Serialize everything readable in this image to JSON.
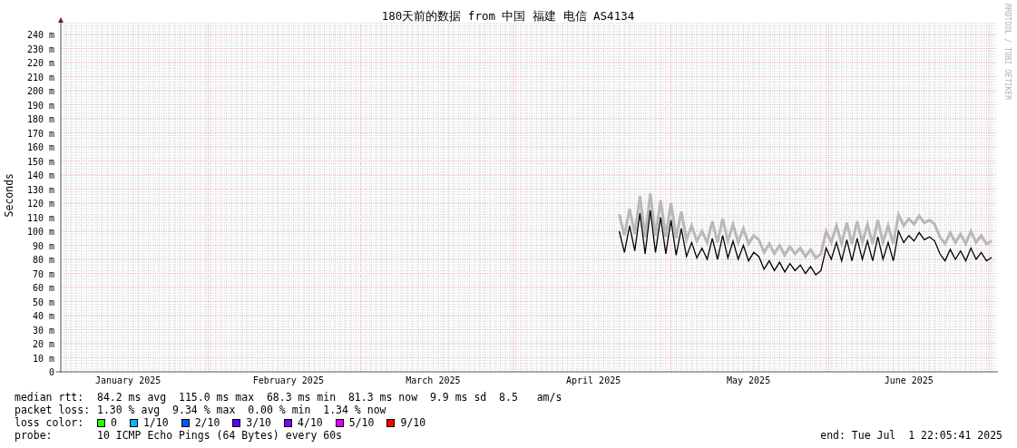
{
  "chart": {
    "chart_data": {
      "type": "line",
      "title": "180天前的数据 from 中国 福建 电信 AS4134",
      "ylabel": "Seconds",
      "categories": [
        null,
        null,
        null,
        null,
        null,
        null,
        null,
        null,
        null,
        null,
        null,
        null,
        null,
        "January 2025",
        null,
        null,
        null,
        null,
        null,
        null,
        null,
        null,
        null,
        null,
        null,
        null,
        null,
        null,
        null,
        null,
        null,
        null,
        null,
        null,
        null,
        null,
        null,
        null,
        null,
        null,
        null,
        null,
        null,
        null,
        "February 2025",
        null,
        null,
        null,
        null,
        null,
        null,
        null,
        null,
        null,
        null,
        null,
        null,
        null,
        null,
        null,
        null,
        null,
        null,
        null,
        null,
        null,
        null,
        null,
        null,
        null,
        null,
        null,
        "March 2025",
        null,
        null,
        null,
        null,
        null,
        null,
        null,
        null,
        null,
        null,
        null,
        null,
        null,
        null,
        null,
        null,
        null,
        null,
        null,
        null,
        null,
        null,
        null,
        null,
        null,
        null,
        null,
        null,
        null,
        null,
        "April 2025",
        null,
        null,
        null,
        null,
        null,
        null,
        null,
        null,
        null,
        null,
        null,
        null,
        null,
        null,
        null,
        null,
        null,
        null,
        null,
        null,
        null,
        null,
        null,
        null,
        null,
        null,
        null,
        null,
        null,
        "May 2025",
        null,
        null,
        null,
        null,
        null,
        null,
        null,
        null,
        null,
        null,
        null,
        null,
        null,
        null,
        null,
        null,
        null,
        null,
        null,
        null,
        null,
        null,
        null,
        null,
        null,
        null,
        null,
        null,
        null,
        null,
        "June 2025",
        null,
        null,
        null,
        null,
        null,
        null,
        null,
        null,
        null,
        null,
        null,
        null,
        null,
        null,
        null,
        null
      ],
      "series": [
        {
          "color": "#b8b8b8",
          "values": [
            null,
            null,
            null,
            null,
            null,
            null,
            null,
            null,
            null,
            null,
            null,
            null,
            null,
            null,
            null,
            null,
            null,
            null,
            null,
            null,
            null,
            null,
            null,
            null,
            null,
            null,
            null,
            null,
            null,
            null,
            null,
            null,
            null,
            null,
            null,
            null,
            null,
            null,
            null,
            null,
            null,
            null,
            null,
            null,
            null,
            null,
            null,
            null,
            null,
            null,
            null,
            null,
            null,
            null,
            null,
            null,
            null,
            null,
            null,
            null,
            null,
            null,
            null,
            null,
            null,
            null,
            null,
            null,
            null,
            null,
            null,
            null,
            null,
            null,
            null,
            null,
            null,
            null,
            null,
            null,
            null,
            null,
            null,
            null,
            null,
            null,
            null,
            null,
            null,
            null,
            null,
            null,
            null,
            null,
            null,
            null,
            null,
            null,
            null,
            null,
            null,
            null,
            null,
            null,
            null,
            null,
            null,
            null,
            112,
            97,
            116,
            98,
            125,
            96,
            127,
            97,
            122,
            96,
            120,
            95,
            114,
            94,
            104,
            93,
            100,
            92,
            107,
            92,
            109,
            93,
            105,
            92,
            102,
            91,
            97,
            94,
            85,
            91,
            84,
            90,
            83,
            89,
            84,
            88,
            82,
            87,
            81,
            84,
            100,
            92,
            104,
            91,
            106,
            91,
            107,
            92,
            105,
            91,
            108,
            92,
            104,
            91,
            112,
            104,
            109,
            105,
            111,
            106,
            108,
            105,
            96,
            91,
            99,
            92,
            98,
            91,
            100,
            92,
            97,
            91,
            93
          ]
        },
        {
          "name": "median rtt:",
          "color": "#000000",
          "values": [
            null,
            null,
            null,
            null,
            null,
            null,
            null,
            null,
            null,
            null,
            null,
            null,
            null,
            null,
            null,
            null,
            null,
            null,
            null,
            null,
            null,
            null,
            null,
            null,
            null,
            null,
            null,
            null,
            null,
            null,
            null,
            null,
            null,
            null,
            null,
            null,
            null,
            null,
            null,
            null,
            null,
            null,
            null,
            null,
            null,
            null,
            null,
            null,
            null,
            null,
            null,
            null,
            null,
            null,
            null,
            null,
            null,
            null,
            null,
            null,
            null,
            null,
            null,
            null,
            null,
            null,
            null,
            null,
            null,
            null,
            null,
            null,
            null,
            null,
            null,
            null,
            null,
            null,
            null,
            null,
            null,
            null,
            null,
            null,
            null,
            null,
            null,
            null,
            null,
            null,
            null,
            null,
            null,
            null,
            null,
            null,
            null,
            null,
            null,
            null,
            null,
            null,
            null,
            null,
            null,
            null,
            null,
            null,
            100,
            85,
            104,
            86,
            113,
            84,
            115,
            85,
            110,
            84,
            108,
            83,
            102,
            82,
            92,
            81,
            88,
            80,
            95,
            80,
            97,
            81,
            93,
            80,
            90,
            79,
            85,
            82,
            73,
            79,
            72,
            78,
            71,
            77,
            72,
            76,
            70,
            75,
            69,
            72,
            88,
            80,
            92,
            79,
            94,
            79,
            95,
            80,
            93,
            79,
            96,
            80,
            92,
            79,
            100,
            92,
            97,
            93,
            99,
            94,
            96,
            93,
            84,
            79,
            87,
            80,
            86,
            79,
            88,
            80,
            85,
            79,
            81.3
          ]
        }
      ],
      "grid": true,
      "ylim": [
        0,
        248
      ],
      "yticks": [
        {
          "value": 0,
          "label": "0"
        },
        {
          "value": 10,
          "label": "10 m"
        },
        {
          "value": 20,
          "label": "20 m"
        },
        {
          "value": 30,
          "label": "30 m"
        },
        {
          "value": 40,
          "label": "40 m"
        },
        {
          "value": 50,
          "label": "50 m"
        },
        {
          "value": 60,
          "label": "60 m"
        },
        {
          "value": 70,
          "label": "70 m"
        },
        {
          "value": 80,
          "label": "80 m"
        },
        {
          "value": 90,
          "label": "90 m"
        },
        {
          "value": 100,
          "label": "100 m"
        },
        {
          "value": 110,
          "label": "110 m"
        },
        {
          "value": 120,
          "label": "120 m"
        },
        {
          "value": 130,
          "label": "130 m"
        },
        {
          "value": 140,
          "label": "140 m"
        },
        {
          "value": 150,
          "label": "150 m"
        },
        {
          "value": 160,
          "label": "160 m"
        },
        {
          "value": 170,
          "label": "170 m"
        },
        {
          "value": 180,
          "label": "180 m"
        },
        {
          "value": 190,
          "label": "190 m"
        },
        {
          "value": 200,
          "label": "200 m"
        },
        {
          "value": 210,
          "label": "210 m"
        },
        {
          "value": 220,
          "label": "220 m"
        },
        {
          "value": 230,
          "label": "230 m"
        },
        {
          "value": 240,
          "label": "240 m"
        }
      ]
    }
  },
  "credit": "RRDTOOL / TOBI OETIKER",
  "stats": [
    {
      "value": "84.2 ms avg  115.0 ms max  68.3 ms min  81.3 ms now  9.9 ms sd  8.5   am/s"
    },
    {
      "label": "packet loss:",
      "value": "1.30 % avg  9.34 % max  0.00 % min  1.34 % now"
    }
  ],
  "loss_color": {
    "label": "loss color:",
    "items": [
      {
        "label": "0",
        "color": "#26ff00"
      },
      {
        "label": "1/10",
        "color": "#00b8ff"
      },
      {
        "label": "2/10",
        "color": "#0059ff"
      },
      {
        "label": "3/10",
        "color": "#5e00ff"
      },
      {
        "label": "4/10",
        "color": "#7e00ff"
      },
      {
        "label": "5/10",
        "color": "#dd00ff"
      },
      {
        "label": "9/10",
        "color": "#ff0000"
      }
    ]
  },
  "probe": {
    "label": "probe:",
    "value": "10 ICMP Echo Pings (64 Bytes) every 60s"
  },
  "end": "end: Tue Jul  1 22:05:41 2025"
}
